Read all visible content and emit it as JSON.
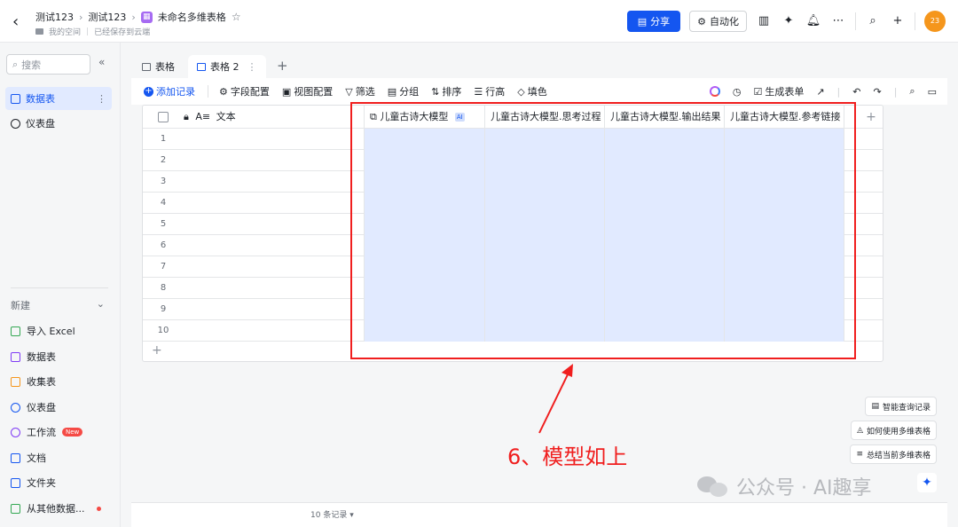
{
  "header": {
    "crumbs": [
      "测试123",
      "测试123"
    ],
    "doc_title": "未命名多维表格",
    "location": "我的空间",
    "save_status": "已经保存到云端",
    "share_label": "分享",
    "automation_label": "自动化",
    "avatar_text": "23"
  },
  "sidebar": {
    "search_placeholder": "搜索",
    "items": [
      {
        "label": "数据表"
      },
      {
        "label": "仪表盘"
      }
    ],
    "new_heading": "新建",
    "new_items": [
      {
        "label": "导入 Excel",
        "color": "#34a853"
      },
      {
        "label": "数据表",
        "color": "#7f3bf5"
      },
      {
        "label": "收集表",
        "color": "#f5961c"
      },
      {
        "label": "仪表盘",
        "color": "#1456f0"
      },
      {
        "label": "工作流",
        "color": "#7f3bf5",
        "badge": "New"
      },
      {
        "label": "文档",
        "color": "#1456f0"
      },
      {
        "label": "文件夹",
        "color": "#1456f0"
      },
      {
        "label": "从其他数据...",
        "color": "#34a853"
      }
    ]
  },
  "tabs": [
    {
      "label": "表格"
    },
    {
      "label": "表格 2"
    }
  ],
  "toolbar": {
    "add_record": "添加记录",
    "field_config": "字段配置",
    "view_config": "视图配置",
    "filter": "筛选",
    "group": "分组",
    "sort": "排序",
    "row_height": "行高",
    "fill_color": "填色",
    "generate_form": "生成表单"
  },
  "grid": {
    "first_column": "文本",
    "ai_columns": [
      "儿童古诗大模型",
      "儿童古诗大模型.思考过程",
      "儿童古诗大模型.输出结果",
      "儿童古诗大模型.参考链接"
    ],
    "ai_tag": "AI",
    "rows": [
      "1",
      "2",
      "3",
      "4",
      "5",
      "6",
      "7",
      "8",
      "9",
      "10"
    ]
  },
  "floating": {
    "smart_query": "智能查询记录",
    "how_to_use": "如何使用多维表格",
    "summarize": "总结当前多维表格"
  },
  "footer": {
    "record_count": "10 条记录"
  },
  "annotation": "6、模型如上",
  "watermark": "公众号 · AI趣享",
  "colors": {
    "accent": "#1456f0",
    "ai_column_bg": "#e1eaff",
    "annotation_red": "#f01e1e"
  }
}
